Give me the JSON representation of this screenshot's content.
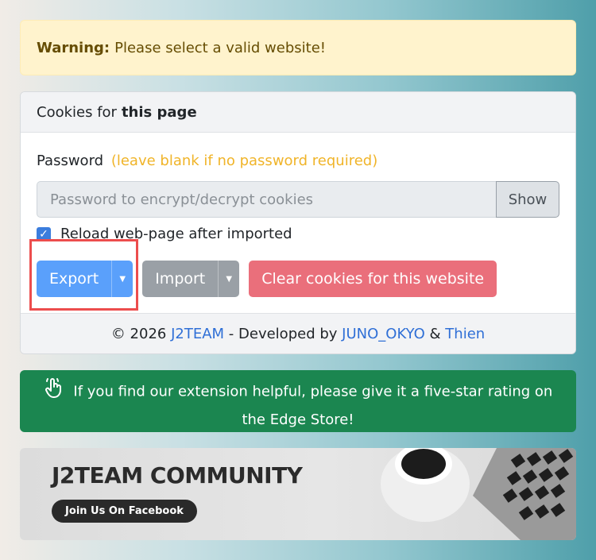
{
  "warning": {
    "label": "Warning:",
    "text": "Please select a valid website!"
  },
  "card": {
    "header_prefix": "Cookies for",
    "header_strong": "this page",
    "password_label": "Password",
    "password_hint": "(leave blank if no password required)",
    "password_placeholder": "Password to encrypt/decrypt cookies",
    "password_value": "",
    "show_button": "Show",
    "reload_checkbox_label": "Reload web-page after imported",
    "reload_checked": true,
    "export_button": "Export",
    "import_button": "Import",
    "clear_button": "Clear cookies for this website",
    "footer": {
      "copyright": "© 2026",
      "team_link": "J2TEAM",
      "developed_by": "- Developed by",
      "dev1_link": "JUNO_OKYO",
      "amp": "&",
      "dev2_link": "Thien"
    }
  },
  "rating_banner": {
    "text": "If you find our extension helpful, please give it a five-star rating on the Edge Store!",
    "icon": "pointing-hand-icon"
  },
  "community_banner": {
    "title": "J2TEAM COMMUNITY",
    "button": "Join Us On Facebook"
  },
  "colors": {
    "export": "#5aa0fb",
    "import": "#9aa0a6",
    "danger": "#ea6f7b",
    "success": "#1b8650",
    "highlight": "#ec4d4d"
  }
}
